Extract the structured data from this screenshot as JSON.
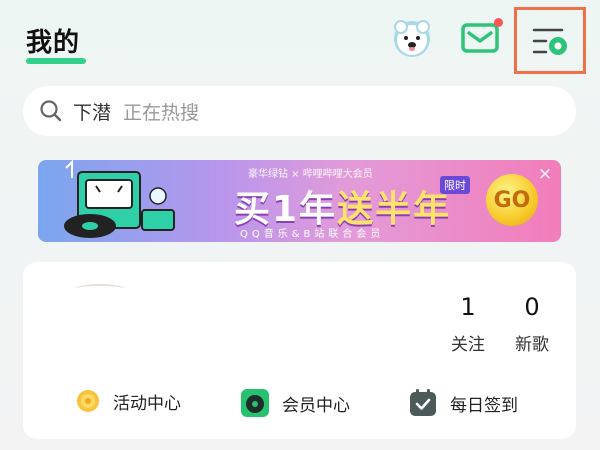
{
  "header": {
    "title": "我的"
  },
  "search": {
    "query": "下潜",
    "hint": "正在热搜"
  },
  "banner": {
    "brand_line": "豪华绿钻 × 哔哩哔哩大会员",
    "headline_part1": "买1年",
    "headline_part2": "送半年",
    "tag": "限时",
    "subtitle": "QQ音乐&B站联合会员",
    "go_label": "GO",
    "close_label": "×"
  },
  "profile": {
    "stats": [
      {
        "value": "1",
        "label": "关注"
      },
      {
        "value": "0",
        "label": "新歌"
      }
    ],
    "quick_links": [
      {
        "label": "活动中心",
        "icon": "coin-icon"
      },
      {
        "label": "会员中心",
        "icon": "vinyl-icon"
      },
      {
        "label": "每日签到",
        "icon": "calendar-check-icon"
      }
    ]
  },
  "colors": {
    "accent_green": "#33d18a",
    "highlight_border": "#f36f4b",
    "notification_dot": "#ff5454"
  }
}
